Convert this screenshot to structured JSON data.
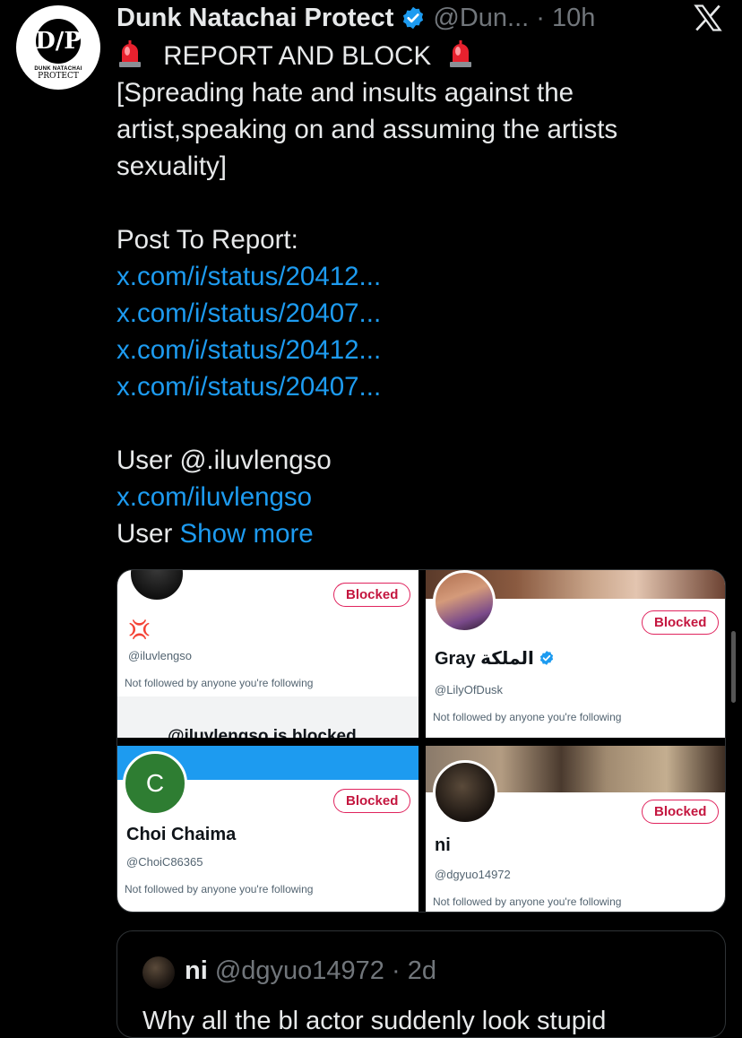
{
  "tweet": {
    "avatar": {
      "initials": "D/P",
      "logo_small": "DUNK NATACHAI",
      "logo_big": "PROTECT"
    },
    "author_name": "Dunk Natachai Protect",
    "author_handle": "@Dun...",
    "time": "· 10h",
    "title": "REPORT AND BLOCK",
    "lines": [
      "[Spreading hate and insults against the",
      "artist,speaking on and assuming the artists",
      "sexuality]"
    ],
    "post_to_report": "Post To Report:",
    "links": [
      "x.com/i/status/20412...",
      "x.com/i/status/20407...",
      "x.com/i/status/20412...",
      "x.com/i/status/20407..."
    ],
    "user_line": "User @.iluvlengso",
    "user_link": "x.com/iluvlengso",
    "user_prefix": "User",
    "show_more": "Show more"
  },
  "media": {
    "blocked_label": "Blocked",
    "note": "Not followed by anyone you're following",
    "cells": [
      {
        "emoji": "💢",
        "handle": "@iluvlengso",
        "extra": "@iluvlengso is blocked"
      },
      {
        "name": "Gray الملكة",
        "handle": "@LilyOfDusk"
      },
      {
        "name": "Choi Chaima",
        "handle": "@ChoiC86365",
        "initial": "C"
      },
      {
        "name": "ni",
        "handle": "@dgyuo14972"
      }
    ]
  },
  "quote": {
    "name": "ni",
    "handle": "@dgyuo14972",
    "time": "· 2d",
    "text": "Why all the bl actor suddenly look stupid"
  },
  "colors": {
    "link": "#1d9bf0",
    "verified": "#1d9bf0",
    "blocked": "#e0245e",
    "background": "#000000"
  }
}
